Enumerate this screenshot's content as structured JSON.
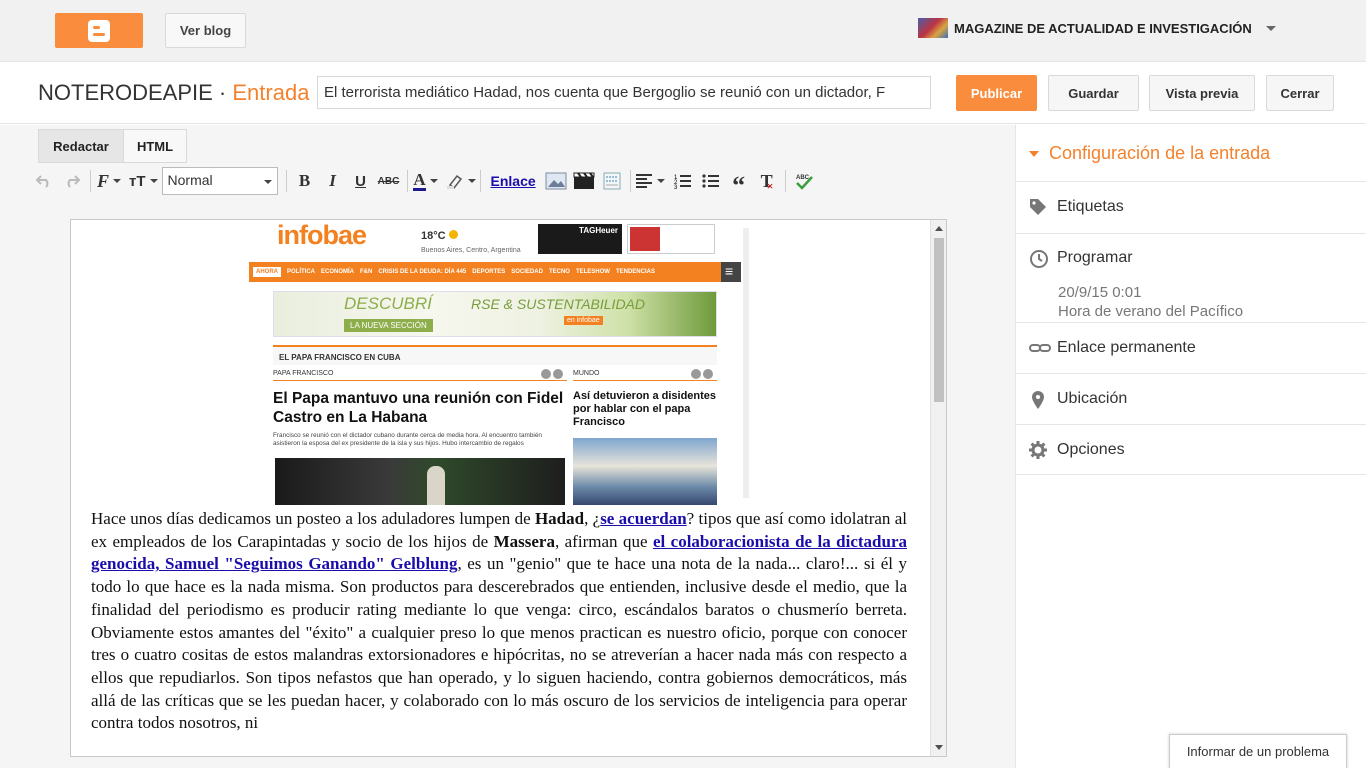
{
  "topbar": {
    "view_blog_label": "Ver blog",
    "blog_name": "MAGAZINE DE ACTUALIDAD E INVESTIGACIÓN"
  },
  "header": {
    "blog_title": "NOTERODEAPIE",
    "separator": " · ",
    "page_type": "Entrada",
    "post_title_value": "El terrorista mediático Hadad, nos cuenta que Bergoglio se reunió con un dictador, F",
    "publish_label": "Publicar",
    "save_label": "Guardar",
    "preview_label": "Vista previa",
    "close_label": "Cerrar"
  },
  "editor": {
    "tabs": [
      "Redactar",
      "HTML"
    ],
    "format_value": "Normal",
    "link_label": "Enlace",
    "toolbar_icons": [
      "undo-icon",
      "redo-icon",
      "font-family-icon",
      "font-size-icon",
      "bold-icon",
      "italic-icon",
      "underline-icon",
      "strikethrough-icon",
      "text-color-icon",
      "highlight-icon",
      "image-icon",
      "video-icon",
      "jump-break-icon",
      "align-icon",
      "numbered-list-icon",
      "bullet-list-icon",
      "quote-icon",
      "clear-format-icon",
      "spellcheck-icon"
    ]
  },
  "embedded_image": {
    "logo": "infobae",
    "temp": "18°C",
    "location": "Buenos Aires, Centro, Argentina",
    "ad_brand": "TAGHeuer",
    "nav_items": [
      "AHORA",
      "POLÍTICA",
      "ECONOMÍA",
      "F&N",
      "CRISIS DE LA DEUDA: DÍA 445",
      "DEPORTES",
      "SOCIEDAD",
      "TECNO",
      "TELESHOW",
      "TENDENCIAS"
    ],
    "banner_word": "DESCUBRÍ",
    "banner_sub": "LA NUEVA SECCIÓN",
    "banner_title": "RSE & SUSTENTABILIDAD",
    "banner_tag": "en infobae",
    "section": "EL PAPA FRANCISCO EN CUBA",
    "main_label": "PAPA FRANCISCO",
    "main_headline": "El Papa mantuvo una reunión con Fidel Castro en La Habana",
    "main_lead": "Francisco se reunió con el dictador cubano durante cerca de media hora. Al encuentro también asistieron la esposa del ex presidente de la isla y sus hijos. Hubo intercambio de regalos",
    "side_label": "MUNDO",
    "side_headline": "Así detuvieron a disidentes por hablar con el papa Francisco"
  },
  "article": {
    "t1": "Hace unos días dedicamos un posteo a los aduladores lumpen de ",
    "b1": "Hadad",
    "t2": ", ¿",
    "link1": "se acuerdan",
    "t3": "? tipos que así como idolatran al ex empleados de los Carapintadas y socio de los hijos de ",
    "b2": "Massera",
    "t4": ", afirman que ",
    "link2": "el colaboracionista de la dictadura genocida, Samuel \"Seguimos Ganando\" Gelblung",
    "t5": ", es un \"genio\" que te hace una nota de la nada... claro!... si él y todo lo que hace es la nada misma. Son productos para descerebrados que entienden, inclusive desde el medio, que la finalidad del periodismo es producir rating mediante lo que venga: circo, escándalos baratos o chusmerío berreta. Obviamente estos amantes del \"éxito\" a cualquier preso lo que menos practican es nuestro oficio, porque con conocer tres o cuatro cositas de estos malandras extorsionadores e hipócritas, no se atreverían a hacer nada más con respecto a ellos que repudiarlos. Son tipos nefastos que han operado, y lo siguen haciendo, contra gobiernos democráticos, más allá de las críticas que se les puedan hacer, y colaborado con lo más oscuro de los servicios de inteligencia para operar contra todos nosotros, ni"
  },
  "sidebar": {
    "title": "Configuración de la entrada",
    "labels": "Etiquetas",
    "schedule": "Programar",
    "schedule_date": "20/9/15 0:01",
    "schedule_tz": "Hora de verano del Pacífico",
    "permalink": "Enlace permanente",
    "location": "Ubicación",
    "options": "Opciones"
  },
  "report_label": "Informar de un problema",
  "colors": {
    "accent": "#f4812c",
    "publish": "#f98d3d",
    "link": "#1a0dab"
  }
}
